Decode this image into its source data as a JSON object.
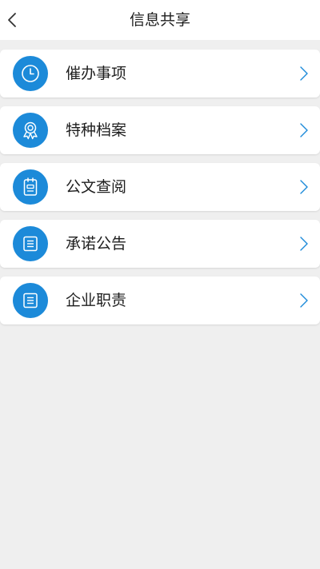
{
  "header": {
    "title": "信息共享",
    "back_icon": "chevron-left-icon"
  },
  "accent_color": "#1c8ad9",
  "menu": [
    {
      "label": "催办事项",
      "icon": "clock-icon"
    },
    {
      "label": "特种档案",
      "icon": "certificate-icon"
    },
    {
      "label": "公文查阅",
      "icon": "notebook-icon"
    },
    {
      "label": "承诺公告",
      "icon": "document-icon"
    },
    {
      "label": "企业职责",
      "icon": "document-icon"
    }
  ]
}
